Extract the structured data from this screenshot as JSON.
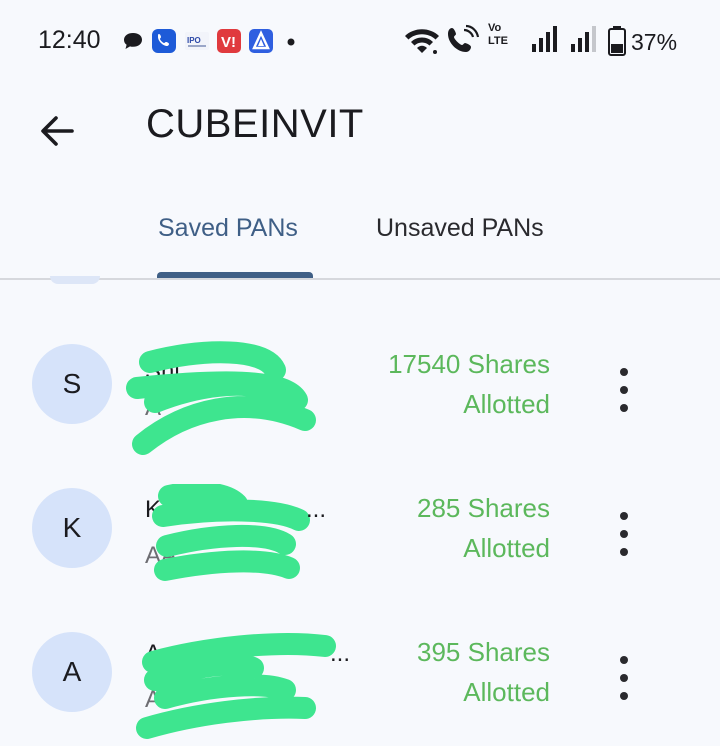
{
  "status_bar": {
    "time": "12:40",
    "battery": "37%",
    "network_label": "Vo LTE",
    "icons": [
      "chat-bubble-icon",
      "phone-app-icon",
      "ipo-app-icon",
      "vi-app-icon",
      "triangle-app-icon",
      "dot-icon",
      "wifi-icon",
      "wifi-calling-icon",
      "volte-icon",
      "signal-icon",
      "signal-icon",
      "battery-icon"
    ]
  },
  "app_bar": {
    "title": "CUBEINVIT",
    "back_icon": "arrow-left-icon"
  },
  "tabs": [
    {
      "label": "Saved PANs",
      "selected": true
    },
    {
      "label": "Unsaved PANs",
      "selected": false
    }
  ],
  "colors": {
    "accent": "#3f5f86",
    "allotted_green": "#5cb85c",
    "avatar_bg": "#d6e3fa",
    "redaction": "#3ee58f"
  },
  "entries": [
    {
      "initial": "S",
      "name": "Shi",
      "pan": "A",
      "shares": "17540 Shares",
      "status": "Allotted"
    },
    {
      "initial": "K",
      "name": "K",
      "pan": "AA",
      "shares": "285 Shares",
      "status": "Allotted"
    },
    {
      "initial": "A",
      "name": "A",
      "pan": "A",
      "shares": "395 Shares",
      "status": "Allotted"
    }
  ]
}
